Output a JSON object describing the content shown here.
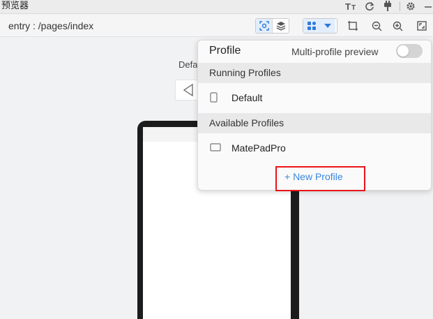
{
  "window": {
    "title": "预览器"
  },
  "toolbar": {
    "route": "entry : /pages/index"
  },
  "canvas": {
    "device_label": "Defa"
  },
  "profile_popup": {
    "title": "Profile",
    "multi_profile_label": "Multi-profile preview",
    "multi_profile_enabled": false,
    "running_header": "Running Profiles",
    "running_profiles": [
      {
        "name": "Default",
        "icon": "phone-icon"
      }
    ],
    "available_header": "Available Profiles",
    "available_profiles": [
      {
        "name": "MatePadPro",
        "icon": "tablet-icon"
      }
    ],
    "new_profile_label": "+ New Profile"
  },
  "colors": {
    "accent": "#3a86e0",
    "highlight": "#e8141b"
  }
}
